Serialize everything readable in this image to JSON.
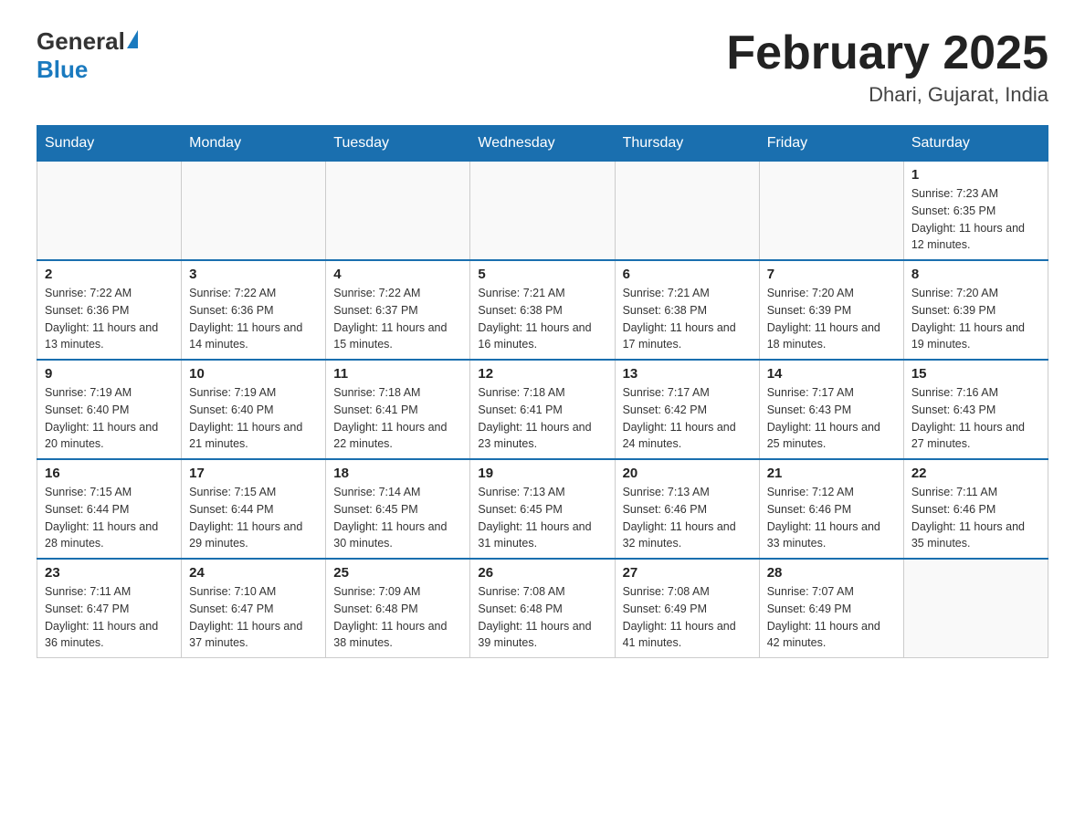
{
  "header": {
    "logo_general": "General",
    "logo_blue": "Blue",
    "title": "February 2025",
    "subtitle": "Dhari, Gujarat, India"
  },
  "days_of_week": [
    "Sunday",
    "Monday",
    "Tuesday",
    "Wednesday",
    "Thursday",
    "Friday",
    "Saturday"
  ],
  "weeks": [
    {
      "cells": [
        {
          "day": "",
          "info": ""
        },
        {
          "day": "",
          "info": ""
        },
        {
          "day": "",
          "info": ""
        },
        {
          "day": "",
          "info": ""
        },
        {
          "day": "",
          "info": ""
        },
        {
          "day": "",
          "info": ""
        },
        {
          "day": "1",
          "info": "Sunrise: 7:23 AM\nSunset: 6:35 PM\nDaylight: 11 hours and 12 minutes."
        }
      ]
    },
    {
      "cells": [
        {
          "day": "2",
          "info": "Sunrise: 7:22 AM\nSunset: 6:36 PM\nDaylight: 11 hours and 13 minutes."
        },
        {
          "day": "3",
          "info": "Sunrise: 7:22 AM\nSunset: 6:36 PM\nDaylight: 11 hours and 14 minutes."
        },
        {
          "day": "4",
          "info": "Sunrise: 7:22 AM\nSunset: 6:37 PM\nDaylight: 11 hours and 15 minutes."
        },
        {
          "day": "5",
          "info": "Sunrise: 7:21 AM\nSunset: 6:38 PM\nDaylight: 11 hours and 16 minutes."
        },
        {
          "day": "6",
          "info": "Sunrise: 7:21 AM\nSunset: 6:38 PM\nDaylight: 11 hours and 17 minutes."
        },
        {
          "day": "7",
          "info": "Sunrise: 7:20 AM\nSunset: 6:39 PM\nDaylight: 11 hours and 18 minutes."
        },
        {
          "day": "8",
          "info": "Sunrise: 7:20 AM\nSunset: 6:39 PM\nDaylight: 11 hours and 19 minutes."
        }
      ]
    },
    {
      "cells": [
        {
          "day": "9",
          "info": "Sunrise: 7:19 AM\nSunset: 6:40 PM\nDaylight: 11 hours and 20 minutes."
        },
        {
          "day": "10",
          "info": "Sunrise: 7:19 AM\nSunset: 6:40 PM\nDaylight: 11 hours and 21 minutes."
        },
        {
          "day": "11",
          "info": "Sunrise: 7:18 AM\nSunset: 6:41 PM\nDaylight: 11 hours and 22 minutes."
        },
        {
          "day": "12",
          "info": "Sunrise: 7:18 AM\nSunset: 6:41 PM\nDaylight: 11 hours and 23 minutes."
        },
        {
          "day": "13",
          "info": "Sunrise: 7:17 AM\nSunset: 6:42 PM\nDaylight: 11 hours and 24 minutes."
        },
        {
          "day": "14",
          "info": "Sunrise: 7:17 AM\nSunset: 6:43 PM\nDaylight: 11 hours and 25 minutes."
        },
        {
          "day": "15",
          "info": "Sunrise: 7:16 AM\nSunset: 6:43 PM\nDaylight: 11 hours and 27 minutes."
        }
      ]
    },
    {
      "cells": [
        {
          "day": "16",
          "info": "Sunrise: 7:15 AM\nSunset: 6:44 PM\nDaylight: 11 hours and 28 minutes."
        },
        {
          "day": "17",
          "info": "Sunrise: 7:15 AM\nSunset: 6:44 PM\nDaylight: 11 hours and 29 minutes."
        },
        {
          "day": "18",
          "info": "Sunrise: 7:14 AM\nSunset: 6:45 PM\nDaylight: 11 hours and 30 minutes."
        },
        {
          "day": "19",
          "info": "Sunrise: 7:13 AM\nSunset: 6:45 PM\nDaylight: 11 hours and 31 minutes."
        },
        {
          "day": "20",
          "info": "Sunrise: 7:13 AM\nSunset: 6:46 PM\nDaylight: 11 hours and 32 minutes."
        },
        {
          "day": "21",
          "info": "Sunrise: 7:12 AM\nSunset: 6:46 PM\nDaylight: 11 hours and 33 minutes."
        },
        {
          "day": "22",
          "info": "Sunrise: 7:11 AM\nSunset: 6:46 PM\nDaylight: 11 hours and 35 minutes."
        }
      ]
    },
    {
      "cells": [
        {
          "day": "23",
          "info": "Sunrise: 7:11 AM\nSunset: 6:47 PM\nDaylight: 11 hours and 36 minutes."
        },
        {
          "day": "24",
          "info": "Sunrise: 7:10 AM\nSunset: 6:47 PM\nDaylight: 11 hours and 37 minutes."
        },
        {
          "day": "25",
          "info": "Sunrise: 7:09 AM\nSunset: 6:48 PM\nDaylight: 11 hours and 38 minutes."
        },
        {
          "day": "26",
          "info": "Sunrise: 7:08 AM\nSunset: 6:48 PM\nDaylight: 11 hours and 39 minutes."
        },
        {
          "day": "27",
          "info": "Sunrise: 7:08 AM\nSunset: 6:49 PM\nDaylight: 11 hours and 41 minutes."
        },
        {
          "day": "28",
          "info": "Sunrise: 7:07 AM\nSunset: 6:49 PM\nDaylight: 11 hours and 42 minutes."
        },
        {
          "day": "",
          "info": ""
        }
      ]
    }
  ]
}
